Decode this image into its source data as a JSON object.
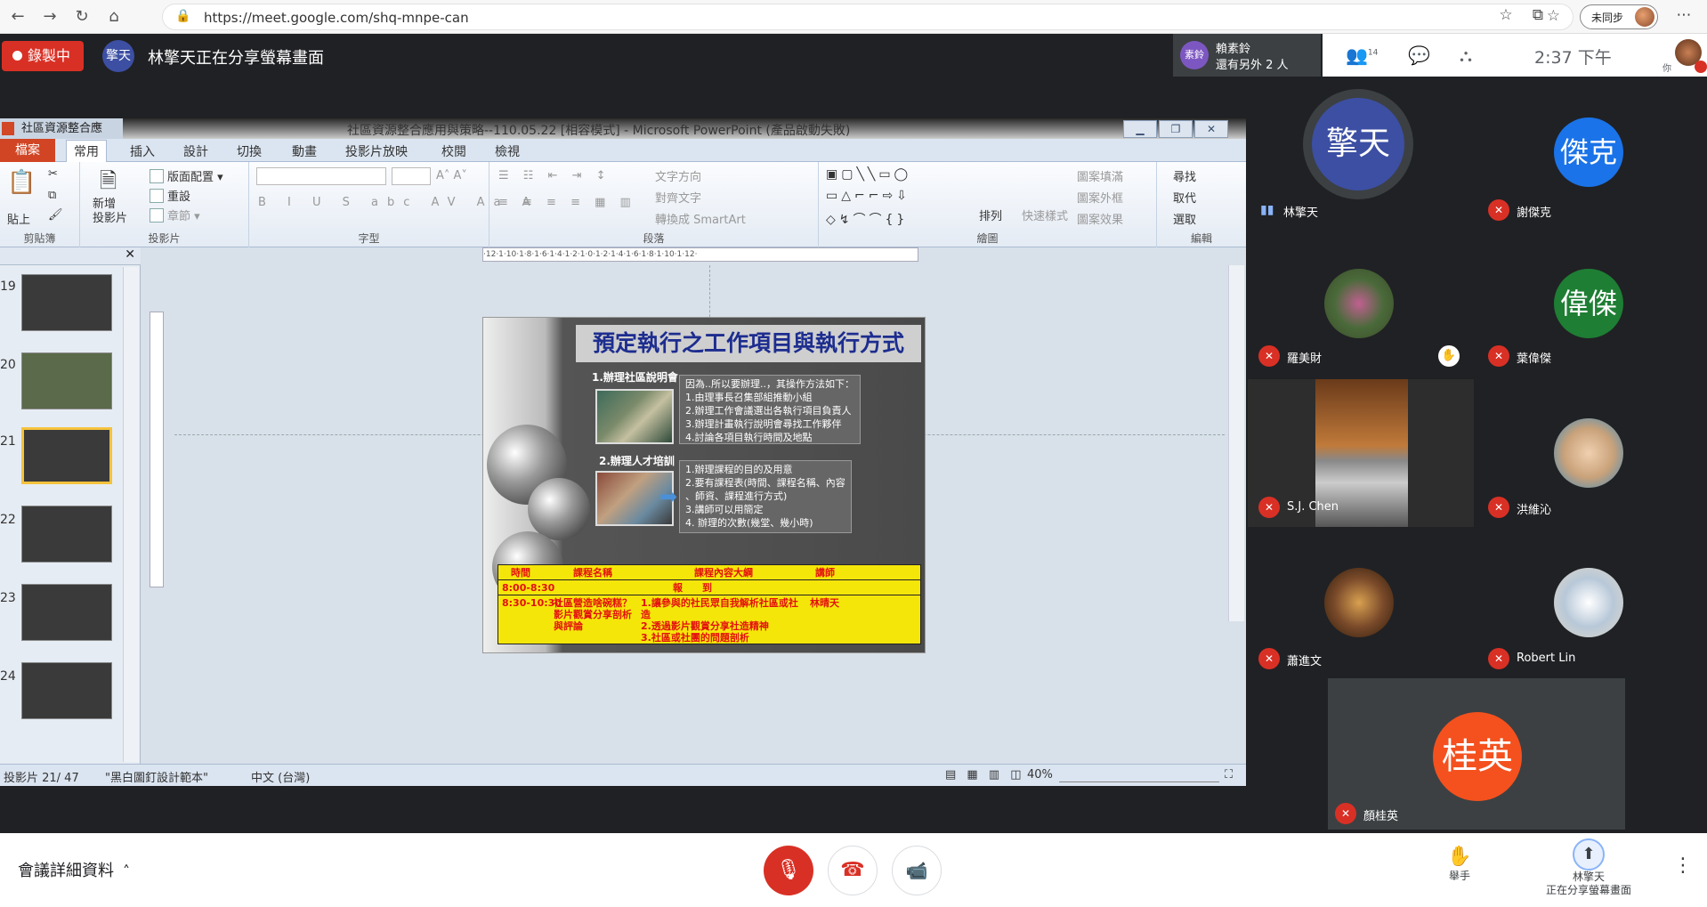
{
  "browser": {
    "url": "https://meet.google.com/shq-mnpe-can",
    "profile_label": "未同步"
  },
  "meet": {
    "recording": "錄製中",
    "presenter_avatar": "擎天",
    "presenter_text": "林擎天正在分享螢幕畫面",
    "speaker_avatar": "素鈴",
    "speaker_name": "賴素鈴",
    "speaker_more": "還有另外 2 人",
    "participant_count": "14",
    "time": "2:37 下午",
    "you_label": "你"
  },
  "ppt": {
    "tab_title": "社區資源整合應",
    "window_title": "社區資源整合應用與策略--110.05.22 [相容模式] - Microsoft PowerPoint (產品啟動失敗)",
    "menu": [
      "檔案",
      "常用",
      "插入",
      "設計",
      "切換",
      "動畫",
      "投影片放映",
      "校閱",
      "檢視"
    ],
    "groups": {
      "clipboard": "剪貼簿",
      "slides": "投影片",
      "font": "字型",
      "paragraph": "段落",
      "drawing": "繪圖",
      "editing": "編輯"
    },
    "buttons": {
      "paste": "貼上",
      "new_slide": "新增\n投影片",
      "layout": "版面配置",
      "reset": "重設",
      "section": "章節",
      "text_dir": "文字方向",
      "align_text": "對齊文字",
      "smartart": "轉換成 SmartArt",
      "arrange": "排列",
      "quick_styles": "快速樣式",
      "fill": "圖案填滿",
      "outline": "圖案外框",
      "effects": "圖案效果",
      "find": "尋找",
      "replace": "取代",
      "select": "選取"
    },
    "thumb_numbers": [
      "19",
      "20",
      "21",
      "22",
      "23",
      "24"
    ],
    "status": {
      "slide": "投影片 21/ 47",
      "theme": "\"黑白圖釘設計範本\"",
      "lang": "中文 (台灣)",
      "zoom": "40%"
    },
    "ruler": "·12·1·10·1·8·1·6·1·4·1·2·1·0·1·2·1·4·1·6·1·8·1·10·1·12·"
  },
  "slide": {
    "title": "預定執行之工作項目與執行方式",
    "item1": "1.辦理社區說明會",
    "item2": "2.辦理人才培訓",
    "box1": [
      "因為..所以要辦理..，其操作方法如下：",
      "1.由理事長召集部組推動小組",
      "2.辦理工作會議選出各執行項目負責人",
      "3.辦理計畫執行說明會尋找工作夥伴",
      "4.討論各項目執行時間及地點"
    ],
    "box2": [
      "1.辦理課程的目的及用意",
      "2.要有課程表(時間、課程名稱、內容",
      "、師資、課程進行方式)",
      "3.講師可以用簡定",
      "4. 辦理的次數(幾堂、幾小時)"
    ],
    "table": {
      "headers": [
        "時間",
        "課程名稱",
        "課程內容大綱",
        "講師"
      ],
      "row1": [
        "8:00-8:30",
        "報　　到"
      ],
      "row2": [
        "8:30-10:30",
        "社區營造啥碗糕？影片觀賞分享剖析與評論",
        "1.讓參與的社民眾自我解析社區或社造\n2.透過影片觀賞分享社造精神\n3.社區或社團的問題剖析",
        "林晴天"
      ]
    }
  },
  "participants": [
    {
      "name": "林擎天",
      "initials": "擎天",
      "color": "#3c4fa3",
      "muted": false
    },
    {
      "name": "謝傑克",
      "initials": "傑克",
      "color": "#1a73e8",
      "muted": true
    },
    {
      "name": "羅美財",
      "initials": "",
      "color": "#6a8a5a",
      "muted": true
    },
    {
      "name": "葉偉傑",
      "initials": "偉傑",
      "color": "#1e7e34",
      "muted": true
    },
    {
      "name": "S.J. Chen",
      "initials": "",
      "color": "#8a5a3a",
      "muted": true
    },
    {
      "name": "洪維沁",
      "initials": "",
      "color": "#c9a27a",
      "muted": true
    },
    {
      "name": "蕭進文",
      "initials": "",
      "color": "#7a4a2a",
      "muted": true
    },
    {
      "name": "Robert Lin",
      "initials": "",
      "color": "#b8c8d8",
      "muted": true
    },
    {
      "name": "顏桂英",
      "initials": "桂英",
      "color": "#f4511e",
      "muted": true
    }
  ],
  "bottom": {
    "details": "會議詳細資料",
    "raise": "舉手",
    "present_name": "林擎天",
    "present_status": "正在分享螢幕畫面"
  }
}
